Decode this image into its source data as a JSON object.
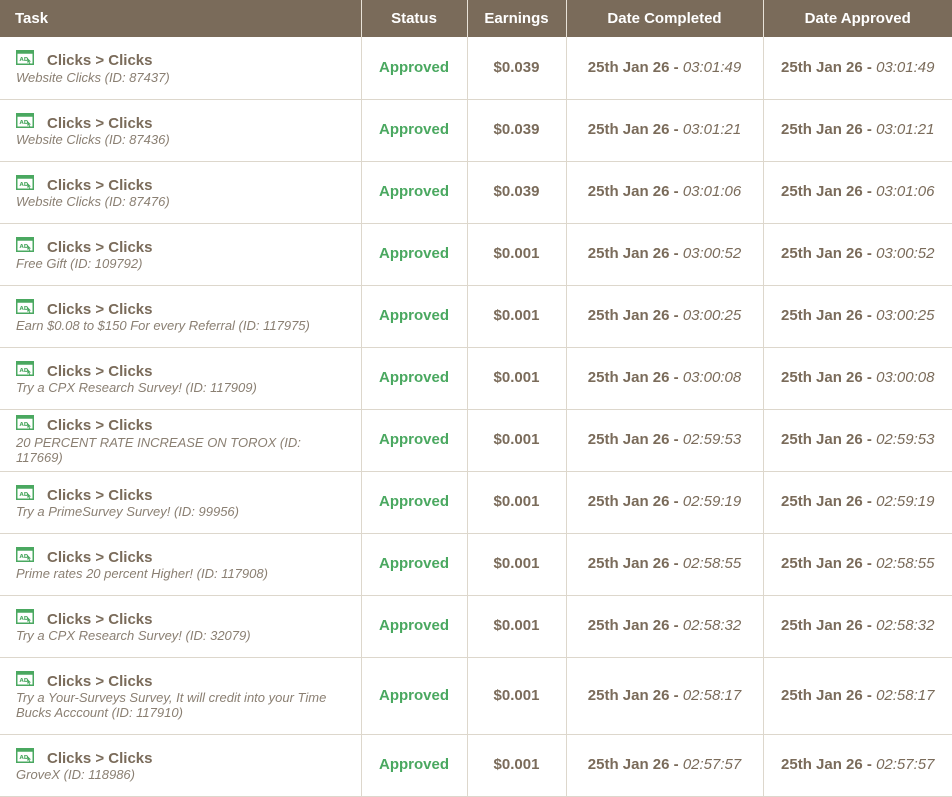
{
  "headers": {
    "task": "Task",
    "status": "Status",
    "earnings": "Earnings",
    "date_completed": "Date Completed",
    "date_approved": "Date Approved"
  },
  "rows": [
    {
      "category": "Clicks > Clicks",
      "desc": "Website Clicks (ID: 87437)",
      "status": "Approved",
      "earnings": "$0.039",
      "completed_date": "25th Jan 26",
      "completed_time": "03:01:49",
      "approved_date": "25th Jan 26",
      "approved_time": "03:01:49"
    },
    {
      "category": "Clicks > Clicks",
      "desc": "Website Clicks (ID: 87436)",
      "status": "Approved",
      "earnings": "$0.039",
      "completed_date": "25th Jan 26",
      "completed_time": "03:01:21",
      "approved_date": "25th Jan 26",
      "approved_time": "03:01:21"
    },
    {
      "category": "Clicks > Clicks",
      "desc": "Website Clicks (ID: 87476)",
      "status": "Approved",
      "earnings": "$0.039",
      "completed_date": "25th Jan 26",
      "completed_time": "03:01:06",
      "approved_date": "25th Jan 26",
      "approved_time": "03:01:06"
    },
    {
      "category": "Clicks > Clicks",
      "desc": "Free Gift (ID: 109792)",
      "status": "Approved",
      "earnings": "$0.001",
      "completed_date": "25th Jan 26",
      "completed_time": "03:00:52",
      "approved_date": "25th Jan 26",
      "approved_time": "03:00:52"
    },
    {
      "category": "Clicks > Clicks",
      "desc": "Earn $0.08 to $150 For every Referral (ID: 117975)",
      "status": "Approved",
      "earnings": "$0.001",
      "completed_date": "25th Jan 26",
      "completed_time": "03:00:25",
      "approved_date": "25th Jan 26",
      "approved_time": "03:00:25"
    },
    {
      "category": "Clicks > Clicks",
      "desc": "Try a CPX Research Survey! (ID: 117909)",
      "status": "Approved",
      "earnings": "$0.001",
      "completed_date": "25th Jan 26",
      "completed_time": "03:00:08",
      "approved_date": "25th Jan 26",
      "approved_time": "03:00:08"
    },
    {
      "category": "Clicks > Clicks",
      "desc": "20 PERCENT RATE INCREASE ON TOROX (ID: 117669)",
      "status": "Approved",
      "earnings": "$0.001",
      "completed_date": "25th Jan 26",
      "completed_time": "02:59:53",
      "approved_date": "25th Jan 26",
      "approved_time": "02:59:53"
    },
    {
      "category": "Clicks > Clicks",
      "desc": "Try a PrimeSurvey Survey! (ID: 99956)",
      "status": "Approved",
      "earnings": "$0.001",
      "completed_date": "25th Jan 26",
      "completed_time": "02:59:19",
      "approved_date": "25th Jan 26",
      "approved_time": "02:59:19"
    },
    {
      "category": "Clicks > Clicks",
      "desc": "Prime rates 20 percent Higher! (ID: 117908)",
      "status": "Approved",
      "earnings": "$0.001",
      "completed_date": "25th Jan 26",
      "completed_time": "02:58:55",
      "approved_date": "25th Jan 26",
      "approved_time": "02:58:55"
    },
    {
      "category": "Clicks > Clicks",
      "desc": "Try a CPX Research Survey! (ID: 32079)",
      "status": "Approved",
      "earnings": "$0.001",
      "completed_date": "25th Jan 26",
      "completed_time": "02:58:32",
      "approved_date": "25th Jan 26",
      "approved_time": "02:58:32"
    },
    {
      "category": "Clicks > Clicks",
      "desc": "Try a Your-Surveys Survey, It will credit into your Time Bucks Acccount (ID: 117910)",
      "status": "Approved",
      "earnings": "$0.001",
      "completed_date": "25th Jan 26",
      "completed_time": "02:58:17",
      "approved_date": "25th Jan 26",
      "approved_time": "02:58:17"
    },
    {
      "category": "Clicks > Clicks",
      "desc": "GroveX (ID: 118986)",
      "status": "Approved",
      "earnings": "$0.001",
      "completed_date": "25th Jan 26",
      "completed_time": "02:57:57",
      "approved_date": "25th Jan 26",
      "approved_time": "02:57:57"
    }
  ],
  "colors": {
    "header_bg": "#7a6b5a",
    "approved": "#4aa860",
    "text": "#7a6b5a",
    "icon": "ad-icon"
  }
}
